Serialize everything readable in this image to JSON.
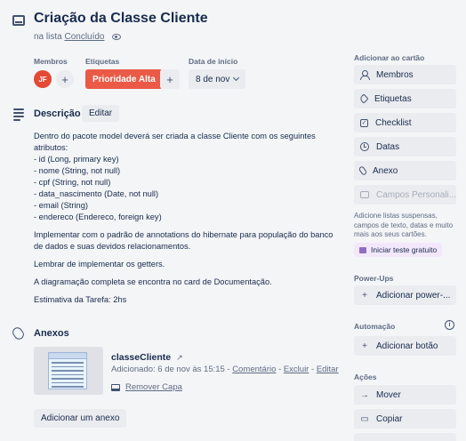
{
  "card": {
    "title": "Criação da Classe Cliente",
    "list_prefix": "na lista",
    "list_name": "Concluído"
  },
  "meta": {
    "members_label": "Membros",
    "member_initials": "JF",
    "labels_label": "Etiquetas",
    "label_text": "Prioridade Alta",
    "label_color": "#eb5a46",
    "start_label": "Data de início",
    "start_value": "8 de nov"
  },
  "description": {
    "title": "Descrição",
    "edit_label": "Editar",
    "intro_lines": [
      "Dentro do pacote model deverá ser criada a classe Cliente com os seguintes",
      "atributos:",
      "- id (Long, primary key)",
      "- nome (String, not null)",
      "- cpf (String, not null)",
      "- data_nascimento (Date, not null)",
      "- email (String)",
      "- endereco (Endereco, foreign key)"
    ],
    "p2_lines": [
      "Implementar com o padrão de annotations do hibernate para população do banco",
      "de dados e suas devidos relacionamentos."
    ],
    "p3": "Lembrar de implementar os getters.",
    "p4": "A diagramação completa se encontra no card de Documentação.",
    "p5": "Estimativa da Tarefa: 2hs"
  },
  "attachments": {
    "title": "Anexos",
    "item": {
      "name": "classeCliente",
      "added": "Adicionado: 6 de nov às 15:15",
      "sep": " - ",
      "comment": "Comentário",
      "delete": "Excluir",
      "edit": "Editar",
      "remove_cover": "Remover Capa"
    },
    "add_label": "Adicionar um anexo"
  },
  "sidebar": {
    "add_to_card": "Adicionar ao cartão",
    "members": "Membros",
    "labels": "Etiquetas",
    "checklist": "Checklist",
    "dates": "Datas",
    "attachment": "Anexo",
    "custom_fields": "Campos Personali...",
    "note": "Adicione listas suspensas, campos de texto, datas e muito mais aos seus cartões.",
    "trial": "Iniciar teste gratuito",
    "powerups_head": "Power-Ups",
    "add_powerup": "Adicionar power-...",
    "automation_head": "Automação",
    "add_button": "Adicionar botão",
    "actions_head": "Ações",
    "move": "Mover",
    "copy": "Copiar"
  },
  "icons": {
    "header": "card-icon",
    "watch": "eye-icon",
    "description": "description-icon",
    "attachments": "paperclip-icon"
  }
}
